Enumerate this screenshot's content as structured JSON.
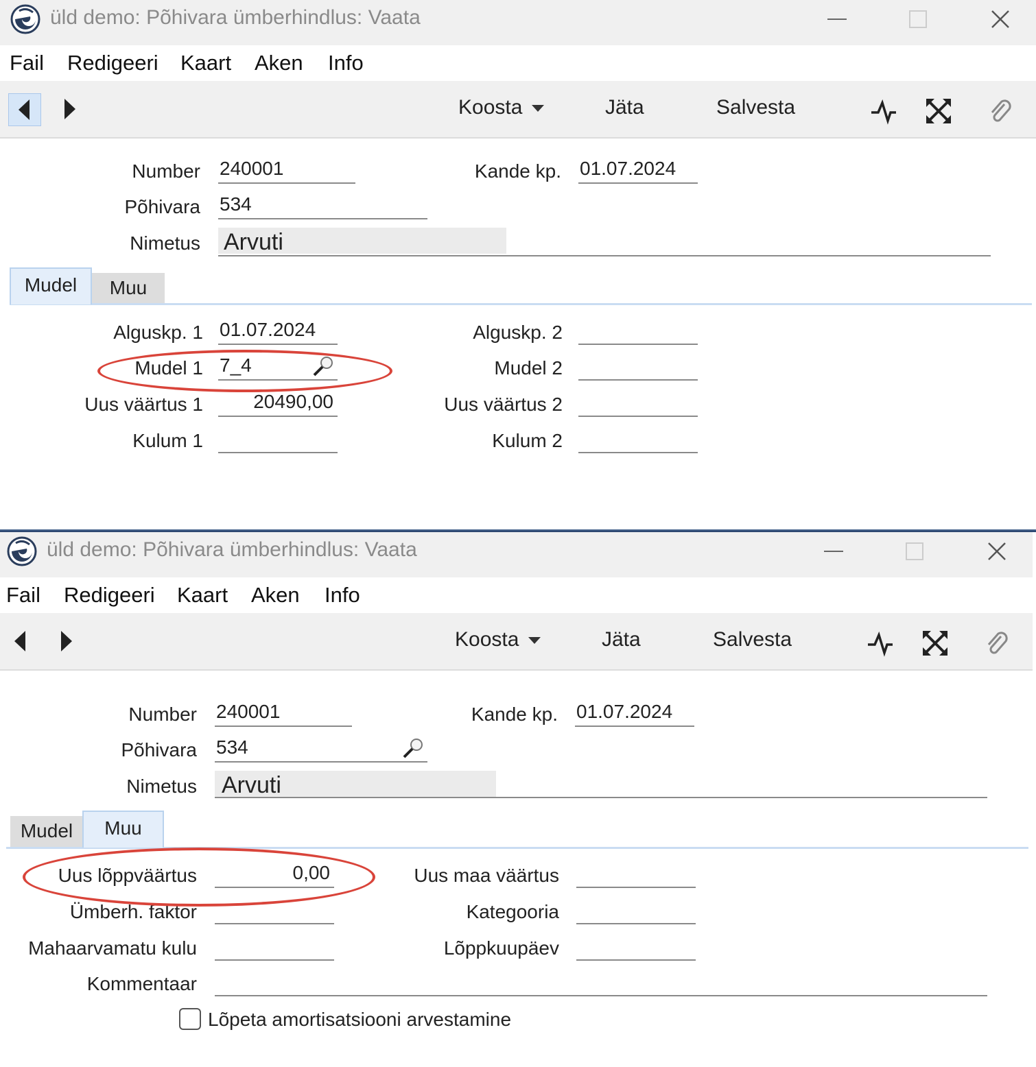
{
  "window1": {
    "title": "üld demo: Põhivara ümberhindlus: Vaata",
    "menu": [
      "Fail",
      "Redigeeri",
      "Kaart",
      "Aken",
      "Info"
    ],
    "toolbar": {
      "koosta": "Koosta",
      "jata": "Jäta",
      "salvesta": "Salvesta"
    },
    "header": {
      "number_label": "Number",
      "number_value": "240001",
      "kande_label": "Kande kp.",
      "kande_value": "01.07.2024",
      "pohivara_label": "Põhivara",
      "pohivara_value": "534",
      "nimetus_label": "Nimetus",
      "nimetus_value": "Arvuti"
    },
    "tabs": [
      {
        "label": "Mudel",
        "active": true
      },
      {
        "label": "Muu",
        "active": false
      }
    ],
    "mudel": {
      "alguskp1_label": "Alguskp. 1",
      "alguskp1_value": "01.07.2024",
      "mudel1_label": "Mudel 1",
      "mudel1_value": "7_4",
      "uus1_label": "Uus väärtus 1",
      "uus1_value": "20490,00",
      "kulum1_label": "Kulum 1",
      "kulum1_value": "",
      "alguskp2_label": "Alguskp. 2",
      "alguskp2_value": "",
      "mudel2_label": "Mudel 2",
      "mudel2_value": "",
      "uus2_label": "Uus väärtus 2",
      "uus2_value": "",
      "kulum2_label": "Kulum 2",
      "kulum2_value": ""
    }
  },
  "window2": {
    "title": "üld demo: Põhivara ümberhindlus: Vaata",
    "menu": [
      "Fail",
      "Redigeeri",
      "Kaart",
      "Aken",
      "Info"
    ],
    "toolbar": {
      "koosta": "Koosta",
      "jata": "Jäta",
      "salvesta": "Salvesta"
    },
    "header": {
      "number_label": "Number",
      "number_value": "240001",
      "kande_label": "Kande kp.",
      "kande_value": "01.07.2024",
      "pohivara_label": "Põhivara",
      "pohivara_value": "534",
      "nimetus_label": "Nimetus",
      "nimetus_value": "Arvuti"
    },
    "tabs": [
      {
        "label": "Mudel",
        "active": false
      },
      {
        "label": "Muu",
        "active": true
      }
    ],
    "muu": {
      "loppvaartus_label": "Uus lõppväärtus",
      "loppvaartus_value": "0,00",
      "faktor_label": "Ümberh. faktor",
      "faktor_value": "",
      "mahaarvamatu_label": "Mahaarvamatu kulu",
      "mahaarvamatu_value": "",
      "kommentaar_label": "Kommentaar",
      "kommentaar_value": "",
      "maa_label": "Uus maa väärtus",
      "maa_value": "",
      "kategooria_label": "Kategooria",
      "kategooria_value": "",
      "loppkuupaev_label": "Lõppkuupäev",
      "loppkuupaev_value": "",
      "checkbox_label": "Lõpeta amortisatsiooni arvestamine",
      "checkbox_checked": false
    }
  },
  "colors": {
    "annotation": "#d9443a",
    "tab_active": "#e4eefa",
    "toolbar_bg": "#f0f0f0"
  }
}
